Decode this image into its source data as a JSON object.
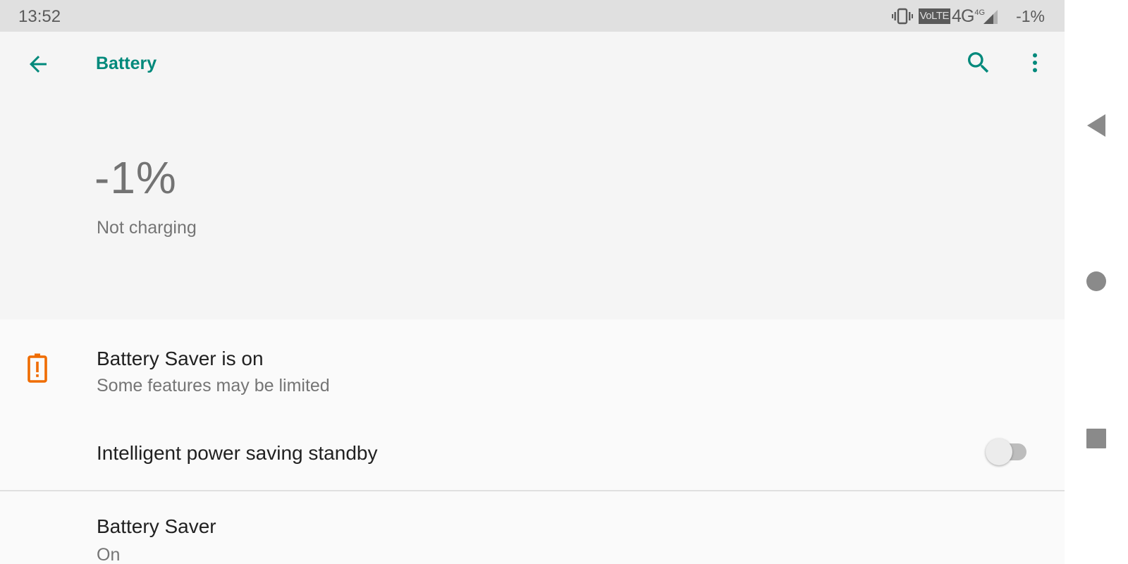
{
  "status_bar": {
    "time": "13:52",
    "volte": "VoLTE",
    "network": "4G",
    "network_sup": "4G",
    "battery_percent": "-1%",
    "icons": [
      "vibrate-icon",
      "volte-icon",
      "signal-icon"
    ]
  },
  "toolbar": {
    "title": "Battery",
    "icons": [
      "back-arrow-icon",
      "search-icon",
      "more-vert-icon"
    ]
  },
  "header": {
    "level": "-1%",
    "status": "Not charging"
  },
  "rows": {
    "saver_banner": {
      "title": "Battery Saver is on",
      "subtitle": "Some features may be limited",
      "icon": "battery-alert-icon"
    },
    "standby": {
      "title": "Intelligent power saving standby",
      "toggle_on": false
    },
    "saver": {
      "title": "Battery Saver",
      "subtitle": "On"
    }
  },
  "nav_bar": {
    "icons": [
      "nav-back-icon",
      "nav-home-icon",
      "nav-recents-icon"
    ]
  },
  "colors": {
    "accent": "#00897b",
    "warning": "#ef6c00",
    "status_bar_bg": "#e0e0e0",
    "header_bg": "#f5f5f5",
    "list_bg": "#fafafa"
  }
}
